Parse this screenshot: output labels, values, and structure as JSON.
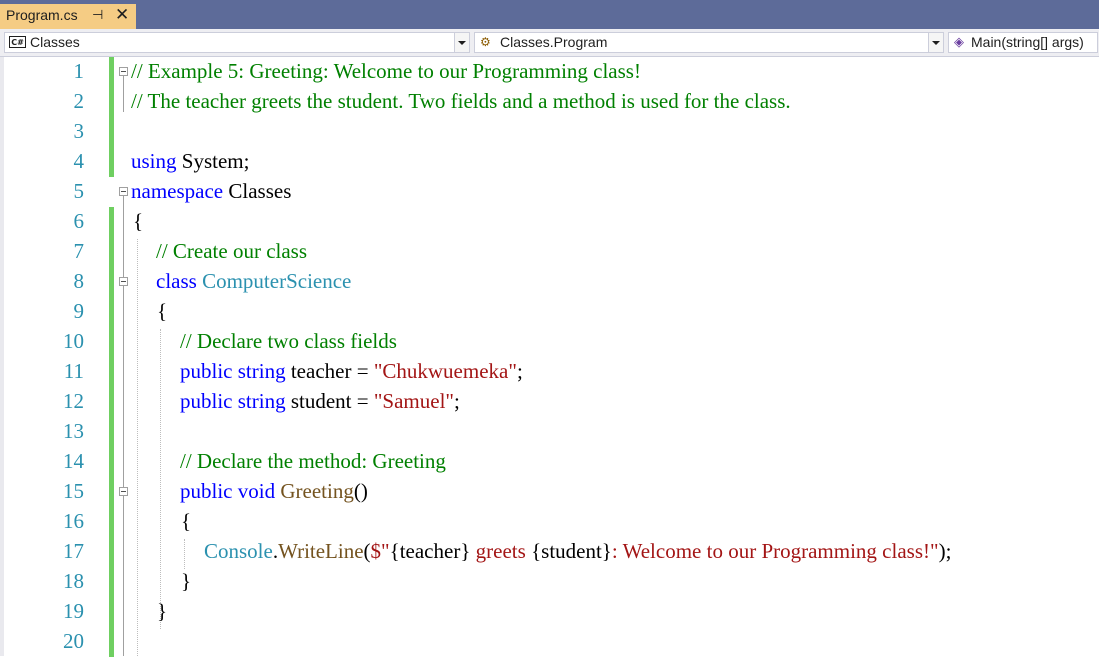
{
  "tab": {
    "title": "Program.cs",
    "pin_glyph": "⊣",
    "close_glyph": "✕"
  },
  "nav": {
    "project": "Classes",
    "class": "Classes.Program",
    "member": "Main(string[] args)"
  },
  "colors": {
    "keyword": "#0000ff",
    "comment": "#008000",
    "type": "#2b91af",
    "string": "#a31515",
    "method": "#74531f",
    "line_number": "#2b91af",
    "modified_bar": "#6fcf61"
  },
  "line_numbers": [
    "1",
    "2",
    "3",
    "4",
    "5",
    "6",
    "7",
    "8",
    "9",
    "10",
    "11",
    "12",
    "13",
    "14",
    "15",
    "16",
    "17",
    "18",
    "19",
    "20"
  ],
  "code": {
    "l1": "// Example 5: Greeting: Welcome to our Programming class!",
    "l2": "// The teacher greets the student. Two fields and a method is used for the class.",
    "l4_kw": "using",
    "l4_rest": " System;",
    "l5_kw": "namespace",
    "l5_rest": " Classes",
    "l6": "{",
    "l7": "// Create our class",
    "l8_kw": "class",
    "l8_type": " ComputerScience",
    "l9": "{",
    "l10": "// Declare two class fields",
    "l11_kw1": "public",
    "l11_kw2": " string",
    "l11_rest": " teacher = ",
    "l11_str": "\"Chukwuemeka\"",
    "l11_end": ";",
    "l12_kw1": "public",
    "l12_kw2": " string",
    "l12_rest": " student = ",
    "l12_str": "\"Samuel\"",
    "l12_end": ";",
    "l14": "// Declare the method: Greeting",
    "l15_kw1": "public",
    "l15_kw2": " void",
    "l15_method": " Greeting",
    "l15_end": "()",
    "l16": "{",
    "l17_type": "Console",
    "l17_dot": ".",
    "l17_method": "WriteLine",
    "l17_paren": "(",
    "l17_s1": "$\"",
    "l17_i1": "{teacher}",
    "l17_s2": " greets ",
    "l17_i2": "{student}",
    "l17_s3": ": Welcome to our Programming class!\"",
    "l17_end": ");",
    "l18": "}",
    "l19": "}"
  }
}
